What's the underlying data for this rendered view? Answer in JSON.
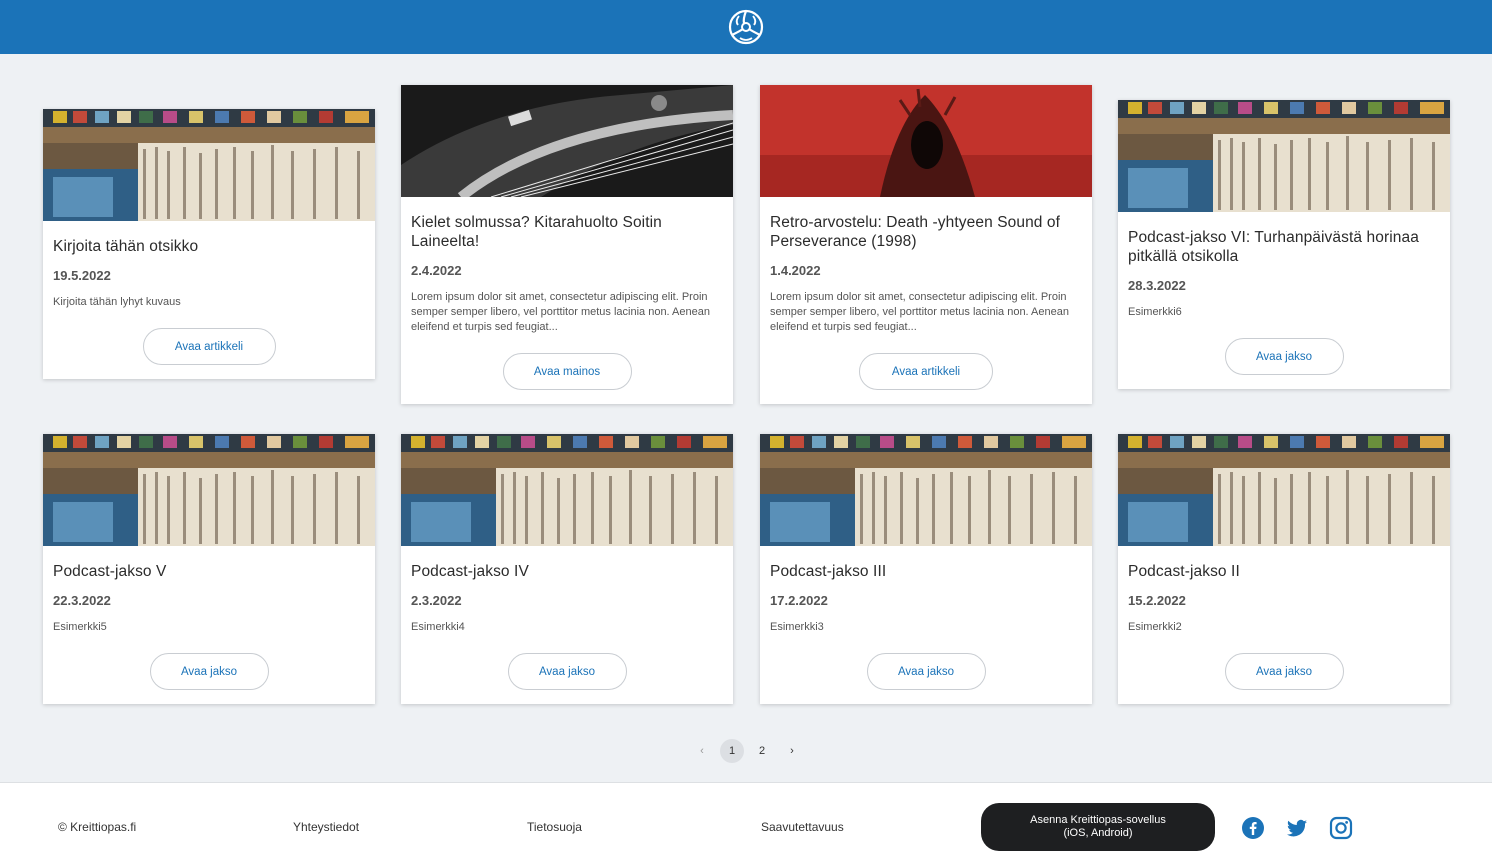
{
  "header": {
    "logo_icon": "record-adapter-logo",
    "brand_color": "#1b73b8"
  },
  "cards": [
    {
      "image": "record-store",
      "title": "Kirjoita tähän otsikko",
      "date": "19.5.2022",
      "desc": "Kirjoita tähän lyhyt kuvaus",
      "button": "Avaa artikkeli"
    },
    {
      "image": "guitar",
      "title": "Kielet solmussa? Kitarahuolto Soitin Laineelta!",
      "date": "2.4.2022",
      "desc": "Lorem ipsum dolor sit amet, consectetur adipiscing elit. Proin semper semper libero, vel porttitor metus lacinia non. Aenean eleifend et turpis sed feugiat...",
      "button": "Avaa mainos"
    },
    {
      "image": "red-album-art",
      "title": "Retro-arvostelu: Death -yhtyeen Sound of Perseverance (1998)",
      "date": "1.4.2022",
      "desc": "Lorem ipsum dolor sit amet, consectetur adipiscing elit. Proin semper semper libero, vel porttitor metus lacinia non. Aenean eleifend et turpis sed feugiat...",
      "button": "Avaa artikkeli"
    },
    {
      "image": "record-store",
      "title": "Podcast-jakso VI: Turhanpäivästä horinaa pitkällä otsikolla",
      "date": "28.3.2022",
      "desc": "Esimerkki6",
      "button": "Avaa jakso"
    },
    {
      "image": "record-store",
      "title": "Podcast-jakso V",
      "date": "22.3.2022",
      "desc": "Esimerkki5",
      "button": "Avaa jakso"
    },
    {
      "image": "record-store",
      "title": "Podcast-jakso IV",
      "date": "2.3.2022",
      "desc": "Esimerkki4",
      "button": "Avaa jakso"
    },
    {
      "image": "record-store",
      "title": "Podcast-jakso III",
      "date": "17.2.2022",
      "desc": "Esimerkki3",
      "button": "Avaa jakso"
    },
    {
      "image": "record-store",
      "title": "Podcast-jakso II",
      "date": "15.2.2022",
      "desc": "Esimerkki2",
      "button": "Avaa jakso"
    }
  ],
  "pagination": {
    "prev": "‹",
    "pages": [
      "1",
      "2"
    ],
    "current": "1",
    "next": "›"
  },
  "footer": {
    "copyright": "© Kreittiopas.fi",
    "contact": "Yhteystiedot",
    "privacy": "Tietosuoja",
    "accessibility": "Saavutettavuus",
    "app_button_line1": "Asenna Kreittiopas-sovellus",
    "app_button_line2": "(iOS, Android)",
    "social": [
      "facebook-icon",
      "twitter-icon",
      "instagram-icon"
    ]
  }
}
